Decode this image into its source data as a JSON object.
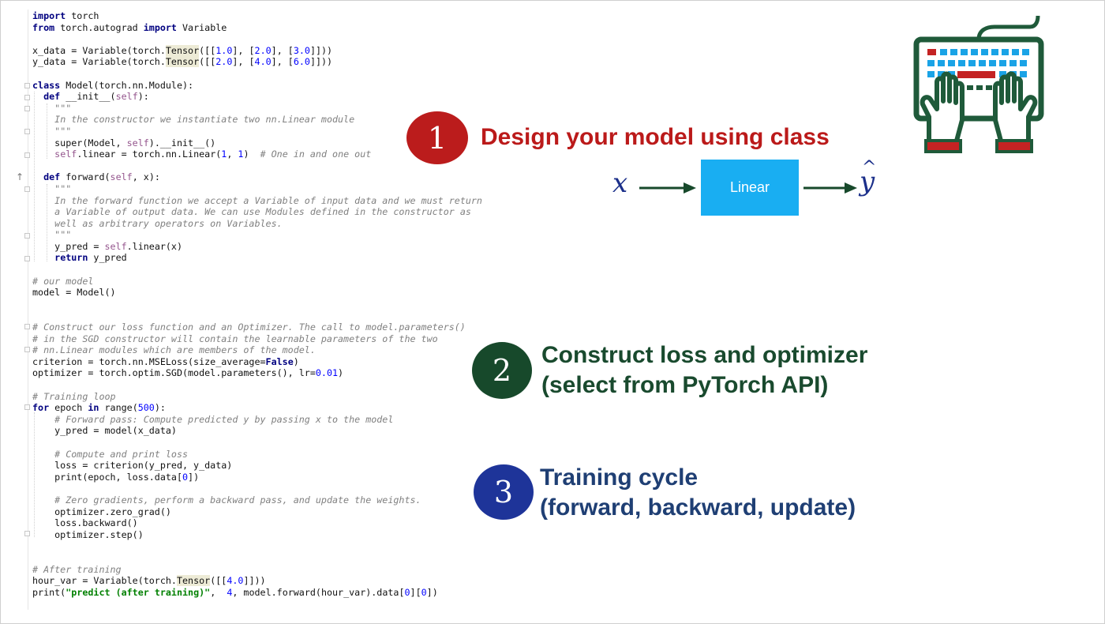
{
  "code_lines": [
    [
      {
        "k": "kw",
        "t": "import"
      },
      {
        "t": " torch"
      }
    ],
    [
      {
        "k": "kw",
        "t": "from"
      },
      {
        "t": " torch.autograd "
      },
      {
        "k": "kw",
        "t": "import"
      },
      {
        "t": " Variable"
      }
    ],
    [],
    [
      {
        "t": "x_data = Variable(torch."
      },
      {
        "k": "hl",
        "t": "Tensor"
      },
      {
        "t": "([["
      },
      {
        "k": "num",
        "t": "1.0"
      },
      {
        "t": "], ["
      },
      {
        "k": "num",
        "t": "2.0"
      },
      {
        "t": "], ["
      },
      {
        "k": "num",
        "t": "3.0"
      },
      {
        "t": "]]))"
      }
    ],
    [
      {
        "t": "y_data = Variable(torch."
      },
      {
        "k": "hl",
        "t": "Tensor"
      },
      {
        "t": "([["
      },
      {
        "k": "num",
        "t": "2.0"
      },
      {
        "t": "], ["
      },
      {
        "k": "num",
        "t": "4.0"
      },
      {
        "t": "], ["
      },
      {
        "k": "num",
        "t": "6.0"
      },
      {
        "t": "]]))"
      }
    ],
    [],
    [
      {
        "k": "kw",
        "t": "class"
      },
      {
        "t": " Model(torch.nn.Module):"
      }
    ],
    [
      {
        "t": "  "
      },
      {
        "k": "kw",
        "t": "def"
      },
      {
        "t": " __init__("
      },
      {
        "k": "slf",
        "t": "self"
      },
      {
        "t": "):"
      }
    ],
    [
      {
        "t": "    "
      },
      {
        "k": "cm",
        "t": "\"\"\""
      }
    ],
    [
      {
        "t": "    "
      },
      {
        "k": "cm",
        "t": "In the constructor we instantiate two nn.Linear module"
      }
    ],
    [
      {
        "t": "    "
      },
      {
        "k": "cm",
        "t": "\"\"\""
      }
    ],
    [
      {
        "t": "    super(Model, "
      },
      {
        "k": "slf",
        "t": "self"
      },
      {
        "t": ").__init__()"
      }
    ],
    [
      {
        "t": "    "
      },
      {
        "k": "slf",
        "t": "self"
      },
      {
        "t": ".linear = torch.nn.Linear("
      },
      {
        "k": "num",
        "t": "1"
      },
      {
        "t": ", "
      },
      {
        "k": "num",
        "t": "1"
      },
      {
        "t": ")  "
      },
      {
        "k": "cm",
        "t": "# One in and one out"
      }
    ],
    [],
    [
      {
        "t": "  "
      },
      {
        "k": "kw",
        "t": "def"
      },
      {
        "t": " forward("
      },
      {
        "k": "slf",
        "t": "self"
      },
      {
        "t": ", x):"
      }
    ],
    [
      {
        "t": "    "
      },
      {
        "k": "cm",
        "t": "\"\"\""
      }
    ],
    [
      {
        "t": "    "
      },
      {
        "k": "cm",
        "t": "In the forward function we accept a Variable of input data and we must return"
      }
    ],
    [
      {
        "t": "    "
      },
      {
        "k": "cm",
        "t": "a Variable of output data. We can use Modules defined in the constructor as"
      }
    ],
    [
      {
        "t": "    "
      },
      {
        "k": "cm",
        "t": "well as arbitrary operators on Variables."
      }
    ],
    [
      {
        "t": "    "
      },
      {
        "k": "cm",
        "t": "\"\"\""
      }
    ],
    [
      {
        "t": "    y_pred = "
      },
      {
        "k": "slf",
        "t": "self"
      },
      {
        "t": ".linear(x)"
      }
    ],
    [
      {
        "t": "    "
      },
      {
        "k": "kw",
        "t": "return"
      },
      {
        "t": " y_pred"
      }
    ],
    [],
    [
      {
        "k": "cm",
        "t": "# our model"
      }
    ],
    [
      {
        "t": "model = Model()"
      }
    ],
    [],
    [],
    [
      {
        "k": "cm",
        "t": "# Construct our loss function and an Optimizer. The call to model.parameters()"
      }
    ],
    [
      {
        "k": "cm",
        "t": "# in the SGD constructor will contain the learnable parameters of the two"
      }
    ],
    [
      {
        "k": "cm",
        "t": "# nn.Linear modules which are members of the model."
      }
    ],
    [
      {
        "t": "criterion = torch.nn.MSELoss(size_average="
      },
      {
        "k": "kw",
        "t": "False"
      },
      {
        "t": ")"
      }
    ],
    [
      {
        "t": "optimizer = torch.optim.SGD(model.parameters(), lr="
      },
      {
        "k": "num",
        "t": "0.01"
      },
      {
        "t": ")"
      }
    ],
    [],
    [
      {
        "k": "cm",
        "t": "# Training loop"
      }
    ],
    [
      {
        "k": "kw",
        "t": "for"
      },
      {
        "t": " epoch "
      },
      {
        "k": "kw",
        "t": "in"
      },
      {
        "t": " range("
      },
      {
        "k": "num",
        "t": "500"
      },
      {
        "t": "):"
      }
    ],
    [
      {
        "t": "    "
      },
      {
        "k": "cm",
        "t": "# Forward pass: Compute predicted y by passing x to the model"
      }
    ],
    [
      {
        "t": "    y_pred = model(x_data)"
      }
    ],
    [],
    [
      {
        "t": "    "
      },
      {
        "k": "cm",
        "t": "# Compute and print loss"
      }
    ],
    [
      {
        "t": "    loss = criterion(y_pred, y_data)"
      }
    ],
    [
      {
        "t": "    print(epoch, loss.data["
      },
      {
        "k": "num",
        "t": "0"
      },
      {
        "t": "])"
      }
    ],
    [],
    [
      {
        "t": "    "
      },
      {
        "k": "cm",
        "t": "# Zero gradients, perform a backward pass, and update the weights."
      }
    ],
    [
      {
        "t": "    optimizer.zero_grad()"
      }
    ],
    [
      {
        "t": "    loss.backward()"
      }
    ],
    [
      {
        "t": "    optimizer.step()"
      }
    ],
    [],
    [],
    [
      {
        "k": "cm",
        "t": "# After training"
      }
    ],
    [
      {
        "t": "hour_var = Variable(torch."
      },
      {
        "k": "hl",
        "t": "Tensor"
      },
      {
        "t": "([["
      },
      {
        "k": "num",
        "t": "4.0"
      },
      {
        "t": "]]))"
      }
    ],
    [
      {
        "t": "print("
      },
      {
        "k": "str",
        "t": "\"predict (after training)\""
      },
      {
        "t": ",  "
      },
      {
        "k": "num",
        "t": "4"
      },
      {
        "t": ", model.forward(hour_var).data["
      },
      {
        "k": "num",
        "t": "0"
      },
      {
        "t": "]["
      },
      {
        "k": "num",
        "t": "0"
      },
      {
        "t": "])"
      }
    ]
  ],
  "steps": [
    {
      "number": "1",
      "line1": "Design your model using class",
      "line2": "",
      "color": "#bb1c1c"
    },
    {
      "number": "2",
      "line1": "Construct loss and optimizer",
      "line2": "(select from PyTorch API)",
      "color": "#17492b"
    },
    {
      "number": "3",
      "line1": "Training cycle",
      "line2": "(forward, backward, update)",
      "color": "#1e3499"
    }
  ],
  "diagram": {
    "input_symbol": "x",
    "box_label": "Linear",
    "output_symbol": "y",
    "output_hat": "^",
    "box_color": "#19aef2",
    "arrow_color": "#17492b"
  },
  "icons": {
    "illustration": "keyboard-typing-icon",
    "gutter_marker": "up-arrow-icon"
  }
}
